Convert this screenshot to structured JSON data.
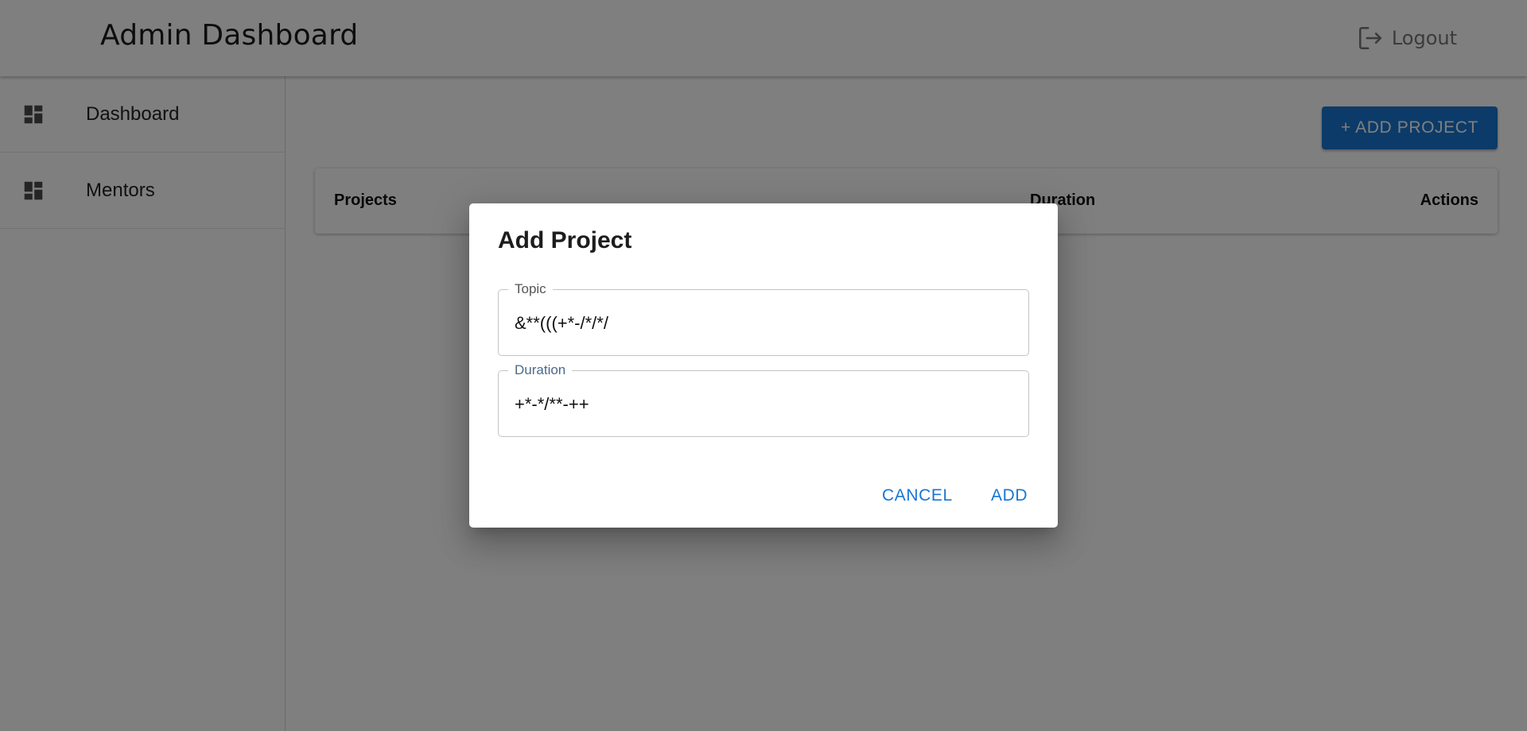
{
  "header": {
    "title": "Admin Dashboard",
    "logout_label": "Logout"
  },
  "sidebar": {
    "items": [
      {
        "label": "Dashboard",
        "icon": "dashboard-icon"
      },
      {
        "label": "Mentors",
        "icon": "dashboard-icon"
      }
    ]
  },
  "main": {
    "add_project_label": "+ ADD PROJECT",
    "table": {
      "columns": [
        "Projects",
        "Duration",
        "Actions"
      ]
    }
  },
  "dialog": {
    "title": "Add Project",
    "topic": {
      "label": "Topic",
      "value": "&**(((+*-/*/*/"
    },
    "duration": {
      "label": "Duration",
      "value": "+*-*/**-++"
    },
    "cancel_label": "CANCEL",
    "add_label": "ADD"
  },
  "colors": {
    "primary": "#1976d2",
    "backdrop": "rgba(0,0,0,0.5)"
  }
}
